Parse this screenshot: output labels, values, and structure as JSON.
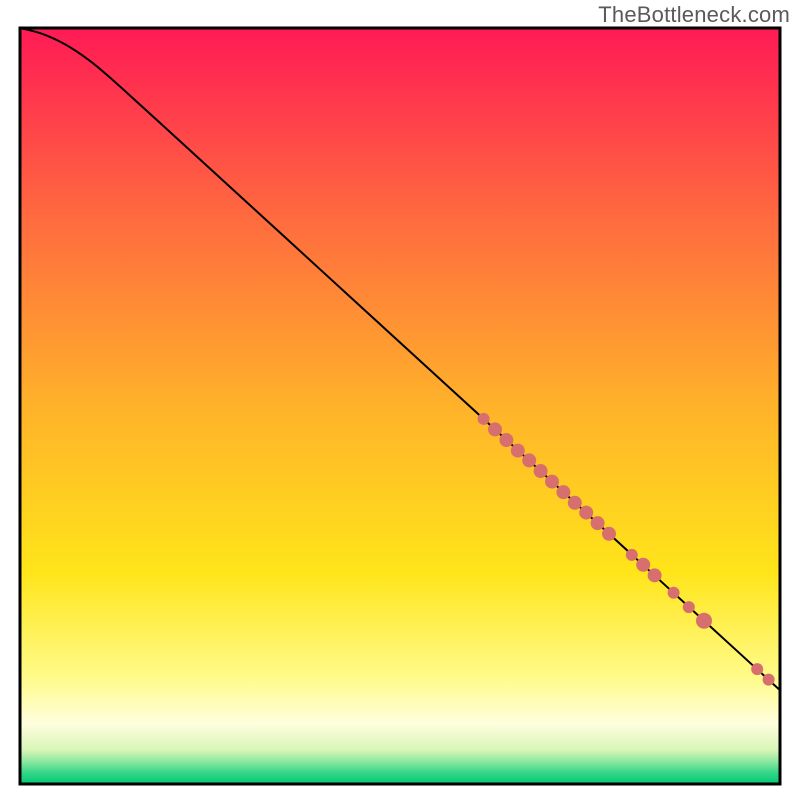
{
  "watermark": "TheBottleneck.com",
  "colors": {
    "curve": "#000000",
    "dot": "#d86f6f",
    "border": "#000000"
  },
  "chart_data": {
    "type": "scatter",
    "title": "",
    "xlabel": "",
    "ylabel": "",
    "xlim": [
      0,
      100
    ],
    "ylim": [
      0,
      100
    ],
    "background_gradient": {
      "type": "vertical",
      "stops": [
        {
          "pos": 0.0,
          "color": "#ff1a55"
        },
        {
          "pos": 0.25,
          "color": "#ff6a3f"
        },
        {
          "pos": 0.5,
          "color": "#ffb22a"
        },
        {
          "pos": 0.72,
          "color": "#ffe51a"
        },
        {
          "pos": 0.86,
          "color": "#fffb8a"
        },
        {
          "pos": 0.92,
          "color": "#fffedd"
        },
        {
          "pos": 0.955,
          "color": "#d9f5b8"
        },
        {
          "pos": 0.97,
          "color": "#8de8a0"
        },
        {
          "pos": 0.985,
          "color": "#35d687"
        },
        {
          "pos": 1.0,
          "color": "#00c974"
        }
      ]
    },
    "curve": {
      "description": "monotone decreasing curve, slight convex bend near top-left, near-linear after x≈10",
      "points": [
        {
          "x": 0,
          "y": 100.0
        },
        {
          "x": 3,
          "y": 99.2
        },
        {
          "x": 6,
          "y": 97.8
        },
        {
          "x": 9,
          "y": 95.8
        },
        {
          "x": 12,
          "y": 93.3
        },
        {
          "x": 20,
          "y": 86.0
        },
        {
          "x": 30,
          "y": 76.8
        },
        {
          "x": 40,
          "y": 67.6
        },
        {
          "x": 50,
          "y": 58.4
        },
        {
          "x": 60,
          "y": 49.2
        },
        {
          "x": 70,
          "y": 40.0
        },
        {
          "x": 80,
          "y": 30.8
        },
        {
          "x": 90,
          "y": 21.6
        },
        {
          "x": 100,
          "y": 12.4
        }
      ]
    },
    "series": [
      {
        "name": "highlighted-segment",
        "color": "#d86f6f",
        "points": [
          {
            "x": 61.0,
            "y": 48.3,
            "r": 6
          },
          {
            "x": 62.5,
            "y": 46.9,
            "r": 7
          },
          {
            "x": 64.0,
            "y": 45.5,
            "r": 7
          },
          {
            "x": 65.5,
            "y": 44.1,
            "r": 7
          },
          {
            "x": 67.0,
            "y": 42.8,
            "r": 7
          },
          {
            "x": 68.5,
            "y": 41.4,
            "r": 7
          },
          {
            "x": 70.0,
            "y": 40.0,
            "r": 7
          },
          {
            "x": 71.5,
            "y": 38.6,
            "r": 7
          },
          {
            "x": 73.0,
            "y": 37.2,
            "r": 7
          },
          {
            "x": 74.5,
            "y": 35.9,
            "r": 7
          },
          {
            "x": 76.0,
            "y": 34.5,
            "r": 7
          },
          {
            "x": 77.5,
            "y": 33.1,
            "r": 7
          },
          {
            "x": 80.5,
            "y": 30.3,
            "r": 6
          },
          {
            "x": 82.0,
            "y": 29.0,
            "r": 7
          },
          {
            "x": 83.5,
            "y": 27.6,
            "r": 7
          },
          {
            "x": 86.0,
            "y": 25.3,
            "r": 6
          },
          {
            "x": 88.0,
            "y": 23.4,
            "r": 6
          },
          {
            "x": 90.0,
            "y": 21.6,
            "r": 8
          },
          {
            "x": 97.0,
            "y": 15.2,
            "r": 6
          },
          {
            "x": 98.5,
            "y": 13.8,
            "r": 6
          }
        ]
      }
    ]
  },
  "geom": {
    "outer": 800,
    "inner_x": 20,
    "inner_y": 28,
    "inner_w": 760,
    "inner_h": 756
  }
}
